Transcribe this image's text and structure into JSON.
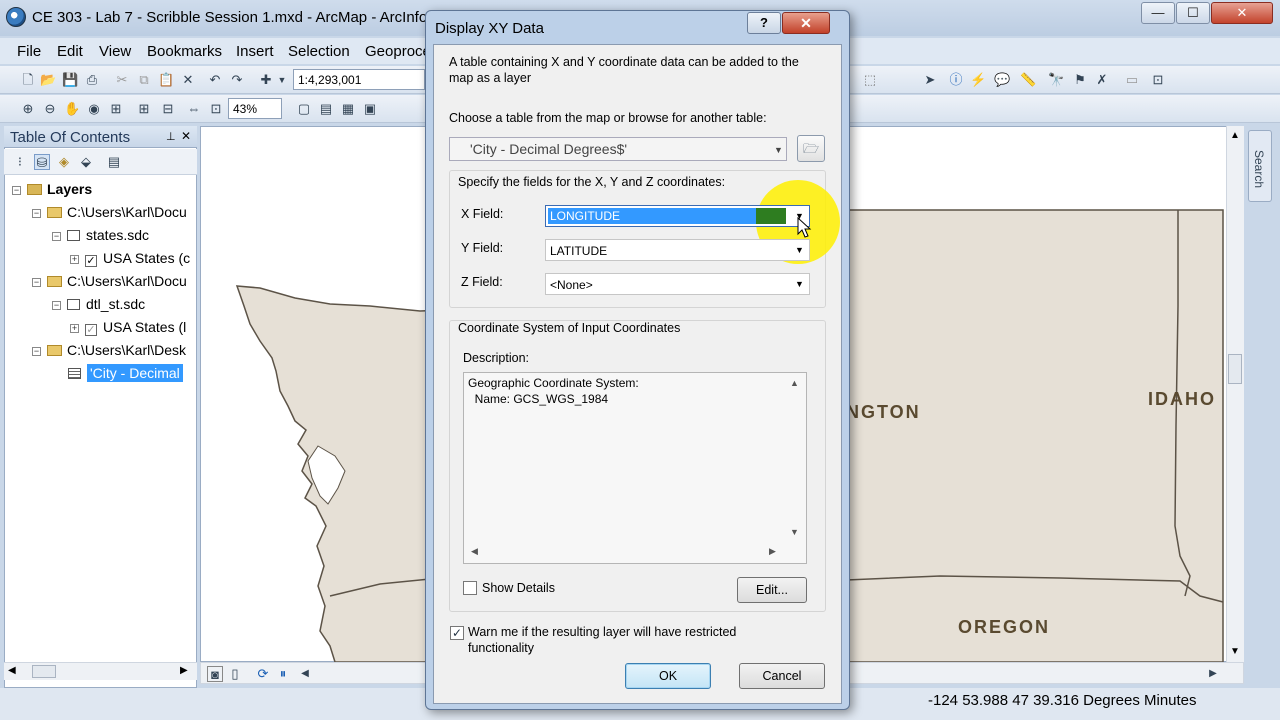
{
  "window": {
    "title": "CE 303 - Lab 7 - Scribble Session 1.mxd - ArcMap - ArcInfo",
    "minimize": "—",
    "maximize": "☐",
    "close": "✕"
  },
  "menu": [
    "File",
    "Edit",
    "View",
    "Bookmarks",
    "Insert",
    "Selection",
    "Geoproce"
  ],
  "toolbar": {
    "scale": "1:4,293,001",
    "zoom": "43%"
  },
  "toc": {
    "title": "Table Of Contents",
    "pin": "📌",
    "close": "✕",
    "items": [
      {
        "label": "Layers"
      },
      {
        "label": "C:\\Users\\Karl\\Docu"
      },
      {
        "label": "states.sdc"
      },
      {
        "label": "USA States (c"
      },
      {
        "label": "C:\\Users\\Karl\\Docu"
      },
      {
        "label": "dtl_st.sdc"
      },
      {
        "label": "USA States (l"
      },
      {
        "label": "C:\\Users\\Karl\\Desk"
      },
      {
        "label": "'City - Decimal"
      }
    ]
  },
  "map": {
    "labels": {
      "washington": "NGTON",
      "idaho": "IDAHO",
      "oregon": "OREGON"
    },
    "colors": {
      "land": "#e6e0d6",
      "border": "#5c5347"
    },
    "search": "Search"
  },
  "status": {
    "coords": "-124 53.988  47 39.316  Degrees Minutes"
  },
  "dialog": {
    "title": "Display XY Data",
    "help": "?",
    "close": "✕",
    "intro": "A table containing X and Y coordinate data can be added to the map as a layer",
    "intro_line1": "A table containing X and Y coordinate data can be added to the",
    "intro_line2": "map as a layer",
    "choose_label": "Choose a table from the map or browse for another table:",
    "table_value": "'City - Decimal Degrees$'",
    "fields_label": "Specify the fields for the X, Y and Z coordinates:",
    "x_label": "X Field:",
    "x_value": "LONGITUDE",
    "y_label": "Y Field:",
    "y_value": "LATITUDE",
    "z_label": "Z Field:",
    "z_value": "<None>",
    "coord_group": "Coordinate System of Input Coordinates",
    "description_label": "Description:",
    "description_line1": "Geographic Coordinate System:",
    "description_line2": "  Name: GCS_WGS_1984",
    "show_details": "Show Details",
    "edit_button": "Edit...",
    "warn_line1": "Warn me if the resulting layer will have restricted",
    "warn_line2": "functionality",
    "ok_button": "OK",
    "cancel_button": "Cancel"
  }
}
